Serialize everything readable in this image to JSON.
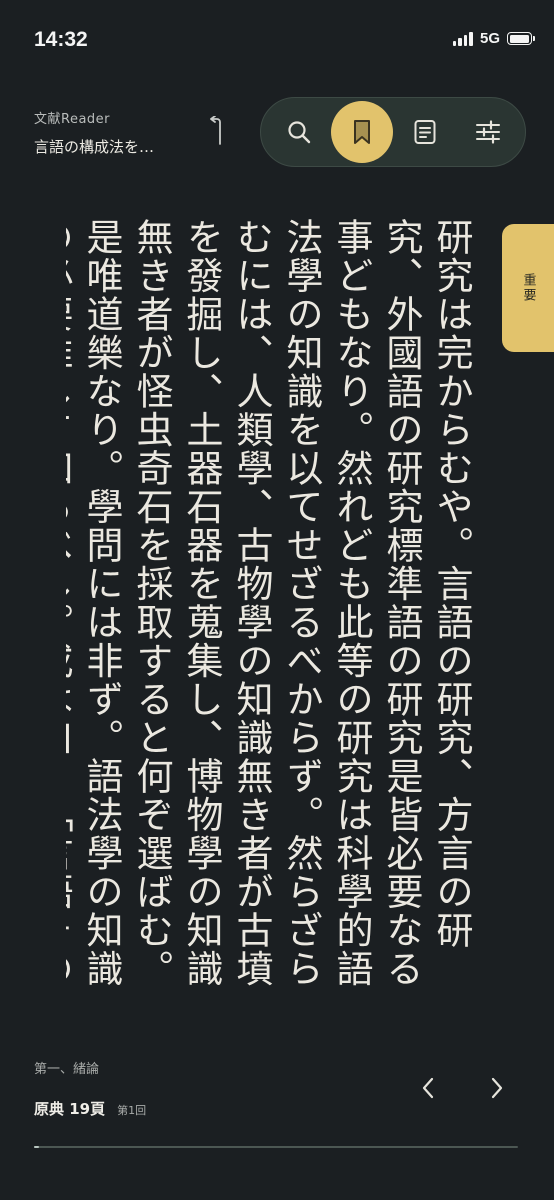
{
  "status_bar": {
    "time": "14:32",
    "network": "5G",
    "signal_icon": "signal-bars-icon",
    "battery_icon": "battery-icon",
    "battery_level": 0.95
  },
  "header": {
    "app_name": "文献Reader",
    "document_title": "言語の構成法を…",
    "back_icon": "return-arrow-icon"
  },
  "toolbar": {
    "items": [
      {
        "icon": "search-icon",
        "active": false
      },
      {
        "icon": "bookmark-icon",
        "active": true
      },
      {
        "icon": "table-of-contents-icon",
        "active": false
      },
      {
        "icon": "settings-sliders-icon",
        "active": false
      }
    ],
    "active_color": "#e2c36c"
  },
  "reading": {
    "text": "研究は完からむや。言語の研究、方言の研究、外國語の研究標準語の研究是皆必要なる事どもなり。然れども此等の研究は科學的語法學の知識を以てせざるべからず。然らざらむには、人類學、古物學の知識無き者が古墳を發掘し、土器石器を蒐集し、博物學の知識無き者が怪虫奇石を採取すると何ぞ選ばむ。是唯道樂なり。學問には非ず。語法學の知識の必要推して知るべし。或は曰く「言語その物の研究"
  },
  "side_tab": {
    "label": "重要",
    "color": "#e2c36c"
  },
  "footer": {
    "chapter": "第一、緒論",
    "page_label": "原典 19頁",
    "read_count": "第1回",
    "prev_icon": "chevron-left-icon",
    "next_icon": "chevron-right-icon",
    "progress": 0.01
  }
}
